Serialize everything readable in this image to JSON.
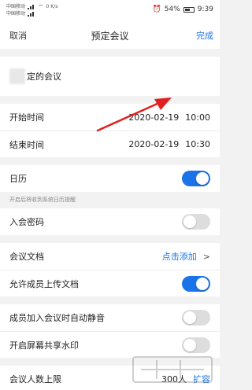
{
  "status": {
    "carrier1": "中国移动",
    "carrier2": "中国移动",
    "speed": "0 K/s",
    "battery": "54%",
    "time": "9:39"
  },
  "nav": {
    "cancel": "取消",
    "title": "预定会议",
    "done": "完成"
  },
  "meeting": {
    "title_suffix": "定的会议"
  },
  "start": {
    "label": "开始时间",
    "date": "2020-02-19",
    "time": "10:00"
  },
  "end": {
    "label": "结束时间",
    "date": "2020-02-19",
    "time": "10:30"
  },
  "calendar": {
    "label": "日历",
    "on": true,
    "hint": "开启后将收到系统日历提醒"
  },
  "password": {
    "label": "入会密码",
    "on": false
  },
  "docs": {
    "label": "会议文档",
    "action": "点击添加",
    "chevron": ">"
  },
  "upload": {
    "label": "允许成员上传文档",
    "on": true
  },
  "mute": {
    "label": "成员加入会议时自动静音",
    "on": false
  },
  "watermark": {
    "label": "开启屏幕共享水印",
    "on": false
  },
  "limit": {
    "label": "会议人数上限",
    "value": "300人",
    "action": "扩容"
  },
  "colors": {
    "accent": "#1a73e8",
    "arrow": "#e02020"
  }
}
